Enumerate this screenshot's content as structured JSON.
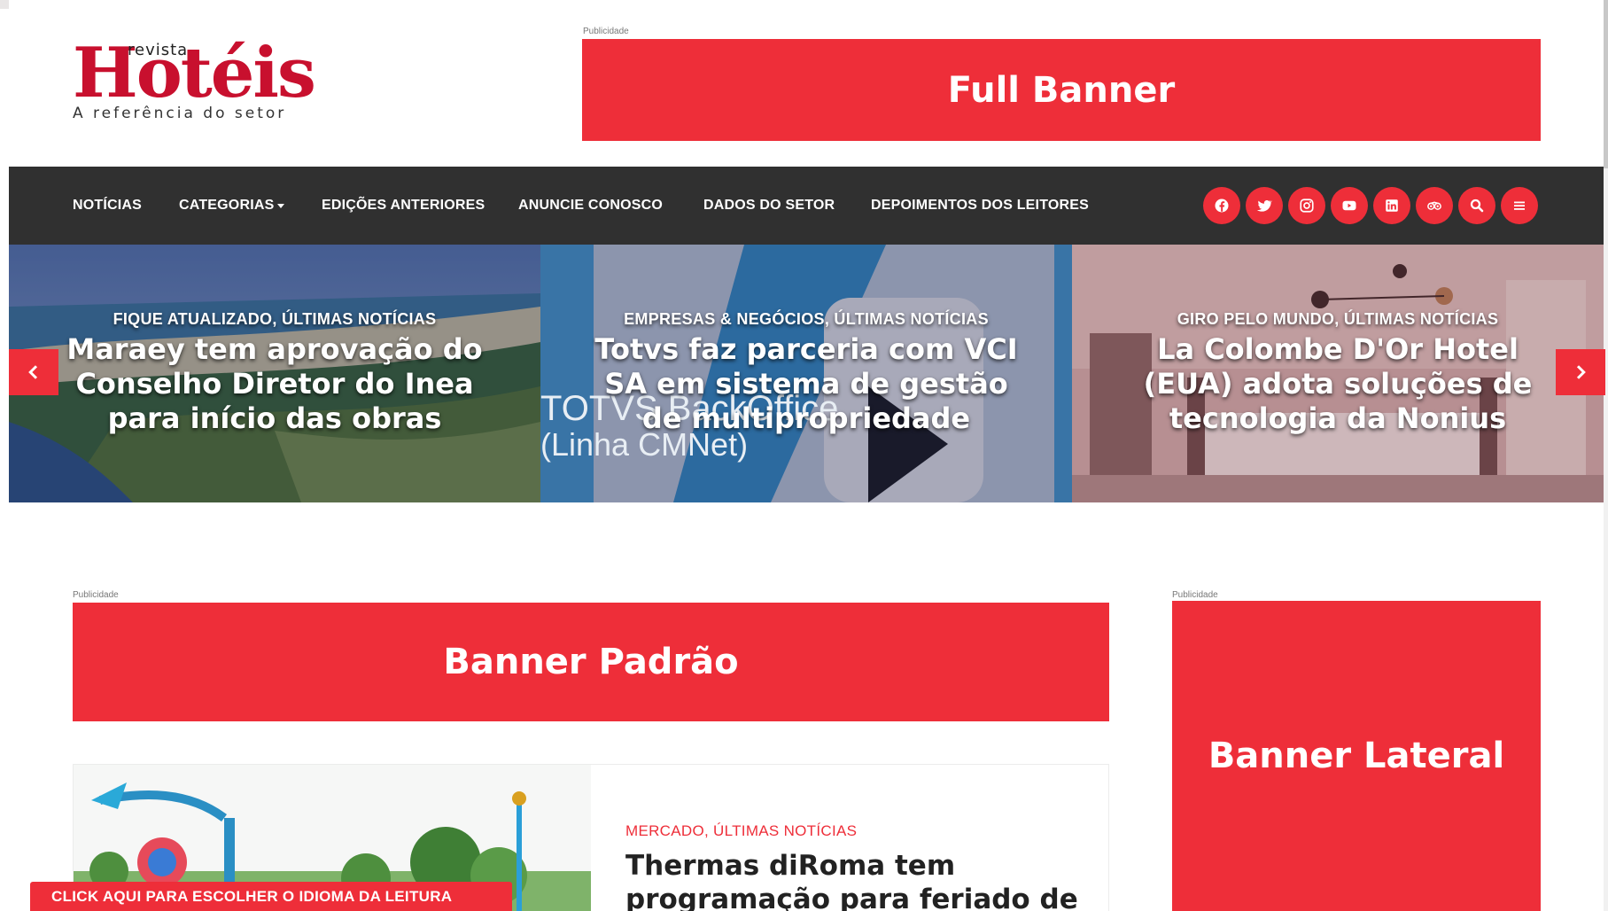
{
  "logo": {
    "revista": "revista",
    "name": "Hotéis",
    "tagline": "A referência do setor"
  },
  "ads": {
    "label": "Publicidade",
    "full_banner": "Full Banner",
    "banner_padrao": "Banner Padrão",
    "banner_lateral": "Banner Lateral"
  },
  "nav": {
    "items": [
      "NOTÍCIAS",
      "CATEGORIAS",
      "EDIÇÕES ANTERIORES",
      "ANUNCIE CONOSCO",
      "DADOS DO SETOR",
      "DEPOIMENTOS DOS LEITORES"
    ],
    "icons": [
      "facebook-icon",
      "twitter-icon",
      "instagram-icon",
      "youtube-icon",
      "linkedin-icon",
      "tripadvisor-icon",
      "search-icon",
      "menu-icon"
    ]
  },
  "slider": {
    "slides": [
      {
        "categories": "FIQUE ATUALIZADO, ÚLTIMAS NOTÍCIAS",
        "title": "Maraey tem aprovação do Conselho Diretor do Inea para início das obras"
      },
      {
        "categories": "EMPRESAS & NEGÓCIOS, ÚLTIMAS NOTÍCIAS",
        "title": "Totvs faz parceria com VCI SA em sistema de gestão de multipropriedade",
        "image_text_1": "TOTVS BackOffice",
        "image_text_2": "(Linha CMNet)"
      },
      {
        "categories": "GIRO PELO MUNDO, ÚLTIMAS NOTÍCIAS",
        "title": "La Colombe D'Or Hotel (EUA) adota soluções de tecnologia da Nonius"
      }
    ]
  },
  "article": {
    "categories": "MERCADO, ÚLTIMAS NOTÍCIAS",
    "title": "Thermas diRoma tem programação para feriado de"
  },
  "language_bar": "CLICK AQUI PARA ESCOLHER O IDIOMA DA LEITURA",
  "colors": {
    "accent": "#ee2e39",
    "nav_bg": "#303030"
  }
}
